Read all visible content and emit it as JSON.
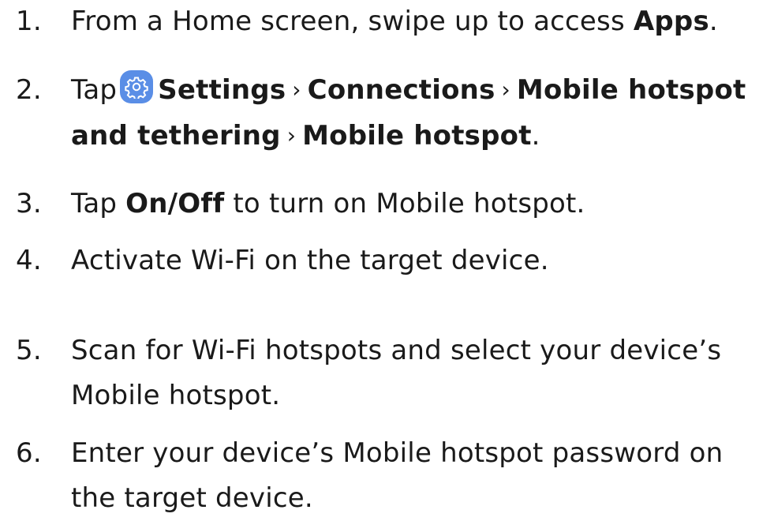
{
  "steps": [
    {
      "number": "1.",
      "text_before": "From a Home screen, swipe up to access ",
      "bold": "Apps",
      "text_after": "."
    },
    {
      "number": "2.",
      "prefix": "Tap",
      "icon": "settings-gear-icon",
      "icon_color": "#5a8ee6",
      "path": [
        "Settings",
        "Connections",
        "Mobile hotspot",
        "and tethering",
        "Mobile hotspot"
      ],
      "separator": "›",
      "end": "."
    },
    {
      "number": "3.",
      "prefix": "Tap ",
      "bold": "On/Off",
      "suffix": " to turn on Mobile hotspot."
    },
    {
      "number": "4.",
      "text": "Activate Wi-Fi on the target device."
    },
    {
      "number": "5.",
      "line1": "Scan for Wi-Fi hotspots and select your device’s",
      "line2": "Mobile hotspot."
    },
    {
      "number": "6.",
      "line1": "Enter your device’s Mobile hotspot password on",
      "line2": "the target device."
    }
  ]
}
